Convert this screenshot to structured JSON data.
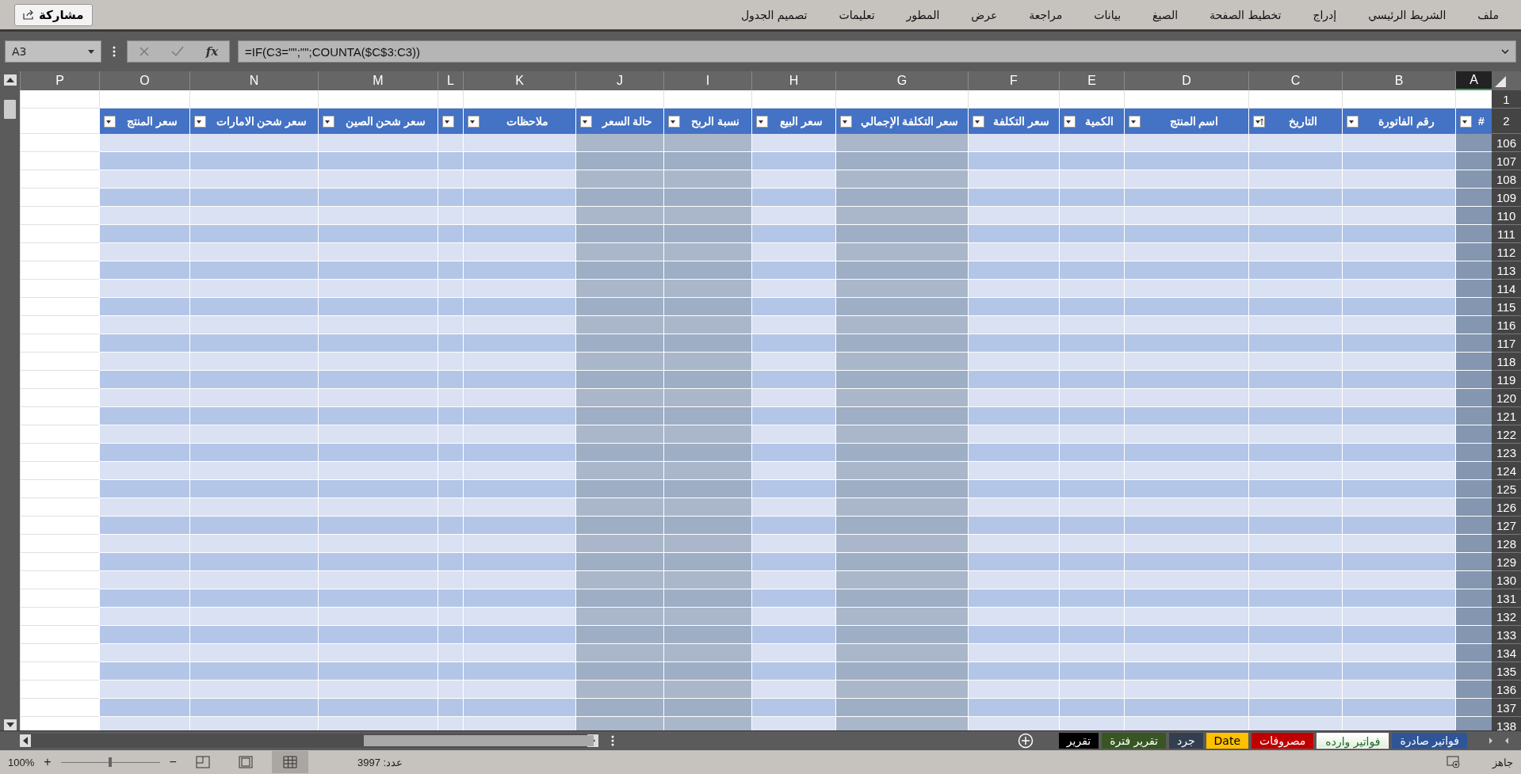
{
  "ribbon": {
    "tabs": [
      "ملف",
      "الشريط الرئيسي",
      "إدراج",
      "تخطيط الصفحة",
      "الصيغ",
      "بيانات",
      "مراجعة",
      "عرض",
      "المطور",
      "تعليمات",
      "تصميم الجدول"
    ],
    "share_button": "مشاركة"
  },
  "formula_bar": {
    "name_box": "A3",
    "fx": "fx",
    "formula": "=IF(C3=\"\";\"\";COUNTA($C$3:C3))"
  },
  "sheet": {
    "columns": [
      {
        "letter": "A",
        "header": "#",
        "kind": "dark",
        "sorted": false,
        "selected": true
      },
      {
        "letter": "B",
        "header": "رقم الفاتورة",
        "kind": "band",
        "sorted": false,
        "selected": false
      },
      {
        "letter": "C",
        "header": "التاريخ",
        "kind": "band",
        "sorted": true,
        "selected": false
      },
      {
        "letter": "D",
        "header": "اسم المنتج",
        "kind": "band",
        "sorted": false,
        "selected": false
      },
      {
        "letter": "E",
        "header": "الكمية",
        "kind": "band",
        "sorted": false,
        "selected": false
      },
      {
        "letter": "F",
        "header": "سعر التكلفة",
        "kind": "band",
        "sorted": false,
        "selected": false
      },
      {
        "letter": "G",
        "header": "سعر التكلفة الإجمالي",
        "kind": "gray",
        "sorted": false,
        "selected": false
      },
      {
        "letter": "H",
        "header": "سعر البيع",
        "kind": "band",
        "sorted": false,
        "selected": false
      },
      {
        "letter": "I",
        "header": "نسبة الربح",
        "kind": "gray",
        "sorted": false,
        "selected": false
      },
      {
        "letter": "J",
        "header": "حالة السعر",
        "kind": "gray",
        "sorted": false,
        "selected": false
      },
      {
        "letter": "K",
        "header": "ملاحظات",
        "kind": "band",
        "sorted": false,
        "selected": false
      },
      {
        "letter": "L",
        "kind": "band",
        "sorted": false,
        "selected": false
      },
      {
        "letter": "M",
        "header": "سعر شحن الصين",
        "kind": "band",
        "sorted": false,
        "selected": false
      },
      {
        "letter": "N",
        "header": "سعر شحن الامارات",
        "kind": "band",
        "sorted": false,
        "selected": false
      },
      {
        "letter": "O",
        "header": "سعر المنتج",
        "kind": "band",
        "sorted": false,
        "selected": false
      },
      {
        "letter": "P",
        "kind": "plain",
        "selected": false
      }
    ],
    "top_rows": [
      "1",
      "2"
    ],
    "rows": [
      "106",
      "107",
      "108",
      "109",
      "110",
      "111",
      "112",
      "113",
      "114",
      "115",
      "116",
      "117",
      "118",
      "119",
      "120",
      "121",
      "122",
      "123",
      "124",
      "125",
      "126",
      "127",
      "128",
      "129",
      "130",
      "131",
      "132",
      "133",
      "134",
      "135",
      "136",
      "137",
      "138"
    ]
  },
  "sheet_tabs": [
    {
      "label": "فواتير صادرة",
      "color": "#2f5597",
      "selected": false
    },
    {
      "label": "فواتير وارده",
      "color": "#e2efda",
      "selected": true
    },
    {
      "label": "مصروفات",
      "color": "#c00000",
      "selected": false
    },
    {
      "label": "Date",
      "color": "#ffc000",
      "selected": false
    },
    {
      "label": "جرد",
      "color": "#333f50",
      "selected": false
    },
    {
      "label": "تقرير فترة",
      "color": "#375623",
      "selected": false
    },
    {
      "label": "تقرير",
      "color": "#000000",
      "selected": false
    }
  ],
  "status_bar": {
    "ready": "جاهز",
    "count": "عدد: 3997",
    "zoom": {
      "level": 0.5,
      "plus": "+",
      "minus": "−",
      "percent": "100%"
    }
  }
}
